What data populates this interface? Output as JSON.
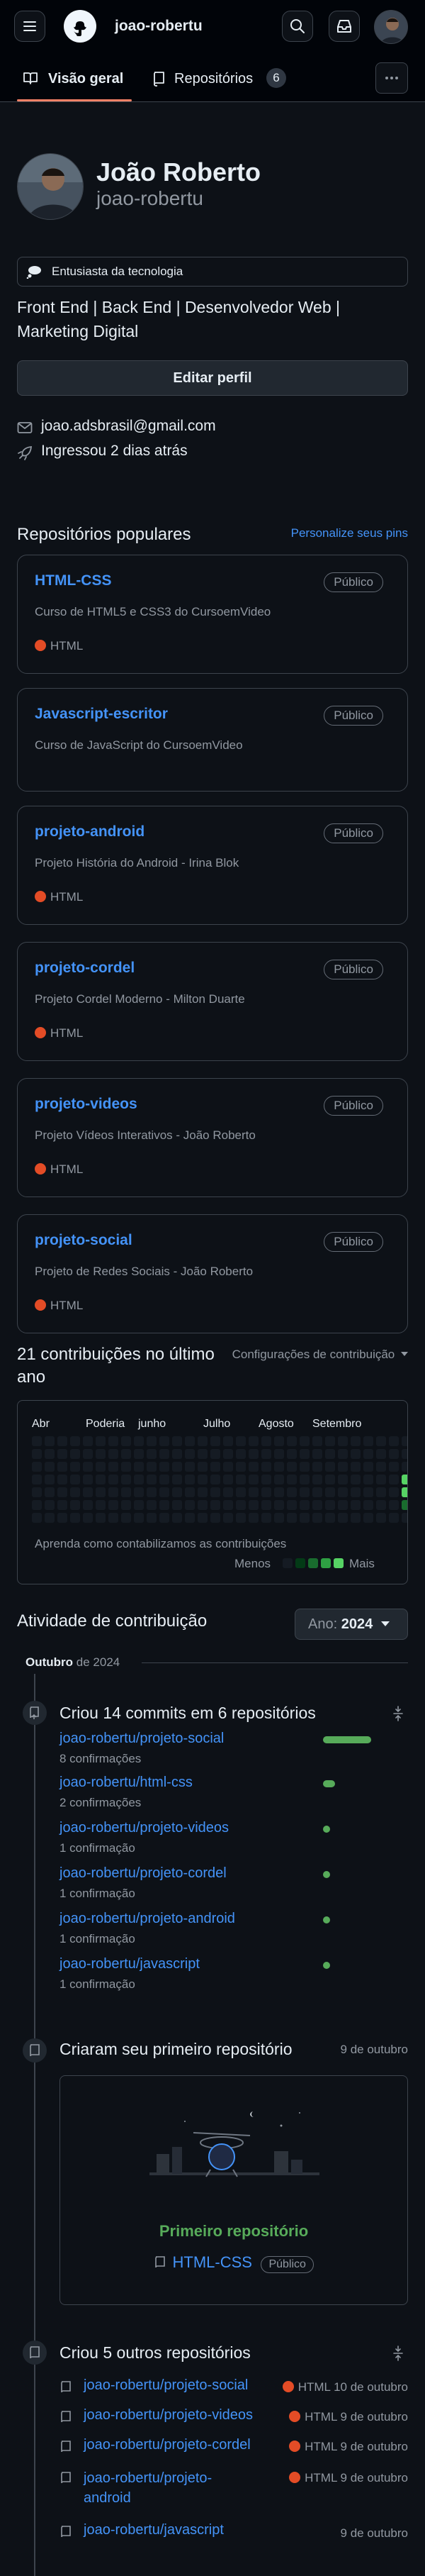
{
  "header": {
    "username": "joao-robertu"
  },
  "tabs": [
    {
      "label": "Visão geral"
    },
    {
      "label": "Repositórios",
      "count": "6"
    }
  ],
  "profile": {
    "name": "João Roberto",
    "login": "joao-robertu",
    "status": "Entusiasta da tecnologia",
    "bio": "Front End | Back End | Desenvolvedor Web | Marketing Digital",
    "edit_label": "Editar perfil",
    "email": "joao.adsbrasil@gmail.com",
    "joined": "Ingressou 2 dias atrás"
  },
  "popular": {
    "title": "Repositórios populares",
    "customize": "Personalize seus pins",
    "repos": [
      {
        "name": "HTML-CSS",
        "visibility": "Público",
        "description": "Curso de HTML5 e CSS3 do CursoemVideo",
        "language": "HTML"
      },
      {
        "name": "Javascript-escritor",
        "visibility": "Público",
        "description": "Curso de JavaScript do CursoemVideo",
        "language": ""
      },
      {
        "name": "projeto-android",
        "visibility": "Público",
        "description": "Projeto História do Android - Irina Blok",
        "language": "HTML"
      },
      {
        "name": "projeto-cordel",
        "visibility": "Público",
        "description": "Projeto Cordel Moderno - Milton Duarte",
        "language": "HTML"
      },
      {
        "name": "projeto-videos",
        "visibility": "Público",
        "description": "Projeto Vídeos Interativos - João Roberto",
        "language": "HTML"
      },
      {
        "name": "projeto-social",
        "visibility": "Público",
        "description": "Projeto de Redes Sociais - João Roberto",
        "language": "HTML"
      }
    ]
  },
  "contrib": {
    "title": "21 contribuições no último ano",
    "settings": "Configurações de contribuição",
    "months": [
      "Abr",
      "Poderia",
      "junho",
      "Julho",
      "Agosto",
      "Setembro"
    ],
    "learn": "Aprenda como contabilizamos as contribuições",
    "less": "Menos",
    "more": "Mais",
    "colors": {
      "empty": "#151b23",
      "l1": "#033a16",
      "l2": "#196c2e",
      "l3": "#2ea043",
      "l4": "#56d364"
    }
  },
  "activity": {
    "title": "Atividade de contribuição",
    "year_label": "Ano:",
    "year": "2024",
    "month_label": "Outubro",
    "month_year": "de 2024",
    "commits": {
      "title": "Criou 14 commits em 6 repositórios",
      "items": [
        {
          "repo": "joao-robertu/projeto-social",
          "count": "8 confirmações",
          "share": 0.57
        },
        {
          "repo": "joao-robertu/html-css",
          "count": "2 confirmações",
          "share": 0.14
        },
        {
          "repo": "joao-robertu/projeto-videos",
          "count": "1 confirmação",
          "share": 0.07
        },
        {
          "repo": "joao-robertu/projeto-cordel",
          "count": "1 confirmação",
          "share": 0.07
        },
        {
          "repo": "joao-robertu/projeto-android",
          "count": "1 confirmação",
          "share": 0.07
        },
        {
          "repo": "joao-robertu/javascript",
          "count": "1 confirmação",
          "share": 0.07
        }
      ]
    },
    "first_repo": {
      "title": "Criaram seu primeiro repositório",
      "date": "9 de outubro",
      "caption": "Primeiro repositório",
      "repo": "HTML-CSS",
      "visibility": "Público"
    },
    "other_repos": {
      "title": "Criou 5 outros repositórios",
      "items": [
        {
          "repo": "joao-robertu/projeto-social",
          "language": "HTML",
          "date": "10 de outubro"
        },
        {
          "repo": "joao-robertu/projeto-videos",
          "language": "HTML",
          "date": "9 de outubro"
        },
        {
          "repo": "joao-robertu/projeto-cordel",
          "language": "HTML",
          "date": "9 de outubro"
        },
        {
          "repo": "joao-robertu/projeto-android",
          "language": "HTML",
          "date": "9 de outubro"
        },
        {
          "repo": "joao-robertu/javascript",
          "language": "",
          "date": "9 de outubro"
        }
      ]
    }
  }
}
